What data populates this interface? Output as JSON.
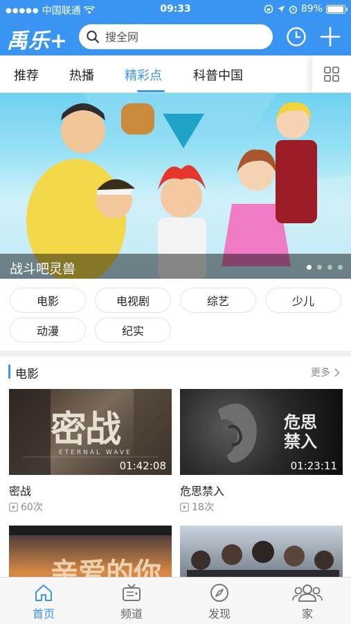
{
  "status_bar": {
    "carrier": "中国联通",
    "time": "09:33",
    "battery_text": "89%",
    "battery_level": 0.89
  },
  "header": {
    "logo_text": "禹乐+",
    "search_placeholder": "搜全网"
  },
  "tabs": [
    {
      "label": "推荐"
    },
    {
      "label": "热播"
    },
    {
      "label": "精彩点"
    },
    {
      "label": "科普中国"
    }
  ],
  "active_tab": "精彩点",
  "banner": {
    "title": "战斗吧灵兽",
    "page_count": 4,
    "current_page": 1
  },
  "categories": [
    "电影",
    "电视剧",
    "综艺",
    "少儿",
    "动漫",
    "纪实"
  ],
  "section": {
    "title": "电影",
    "more_label": "更多",
    "items": [
      {
        "title": "密战",
        "duration": "01:42:08",
        "plays": "60次",
        "poster_text": "密战",
        "poster_sub": "ETERNAL WAVE"
      },
      {
        "title": "危思禁入",
        "duration": "01:23:11",
        "plays": "18次",
        "poster_text": "危思禁入"
      },
      {
        "title": "",
        "duration": "",
        "plays": "",
        "poster_text": "亲爱的你"
      },
      {
        "title": "",
        "duration": "",
        "plays": "",
        "poster_text": ""
      }
    ]
  },
  "bottom_nav": [
    {
      "label": "首页",
      "icon": "home-icon",
      "active": true
    },
    {
      "label": "频道",
      "icon": "tv-icon",
      "active": false
    },
    {
      "label": "发现",
      "icon": "compass-icon",
      "active": false
    },
    {
      "label": "家",
      "icon": "family-icon",
      "active": false
    }
  ],
  "colors": {
    "accent": "#3a95f2",
    "text": "#222222",
    "muted": "#888888"
  }
}
